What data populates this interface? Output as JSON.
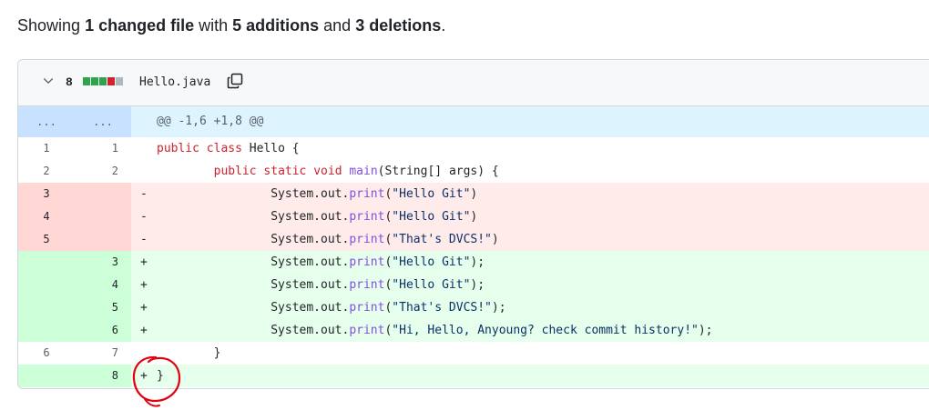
{
  "summary": {
    "prefix": "Showing ",
    "files": "1 changed file",
    "mid": " with ",
    "additions": "5 additions",
    "and": " and ",
    "deletions": "3 deletions",
    "suffix": "."
  },
  "file": {
    "change_count": "8",
    "name": "Hello.java",
    "diffstat_colors": [
      "#2da44e",
      "#2da44e",
      "#2da44e",
      "#cf222e",
      "#afb8c1"
    ]
  },
  "hunk": {
    "old": "...",
    "new": "...",
    "header": "@@ -1,6 +1,8 @@"
  },
  "lines": [
    {
      "type": "ctx",
      "old": "1",
      "new": "1",
      "marker": "",
      "code": "public class Hello {"
    },
    {
      "type": "ctx",
      "old": "2",
      "new": "2",
      "marker": "",
      "code": "        public static void main(String[] args) {"
    },
    {
      "type": "del",
      "old": "3",
      "new": "",
      "marker": "-",
      "code": "                System.out.print(\"Hello Git\")"
    },
    {
      "type": "del",
      "old": "4",
      "new": "",
      "marker": "-",
      "code": "                System.out.print(\"Hello Git\")"
    },
    {
      "type": "del",
      "old": "5",
      "new": "",
      "marker": "-",
      "code": "                System.out.print(\"That's DVCS!\")"
    },
    {
      "type": "add",
      "old": "",
      "new": "3",
      "marker": "+",
      "code": "                System.out.print(\"Hello Git\");"
    },
    {
      "type": "add",
      "old": "",
      "new": "4",
      "marker": "+",
      "code": "                System.out.print(\"Hello Git\");"
    },
    {
      "type": "add",
      "old": "",
      "new": "5",
      "marker": "+",
      "code": "                System.out.print(\"That's DVCS!\");"
    },
    {
      "type": "add",
      "old": "",
      "new": "6",
      "marker": "+",
      "code": "                System.out.print(\"Hi, Hello, Anyoung? check commit history!\");"
    },
    {
      "type": "ctx",
      "old": "6",
      "new": "7",
      "marker": "",
      "code": "        }"
    },
    {
      "type": "add",
      "old": "",
      "new": "8",
      "marker": "+",
      "code": "}"
    }
  ],
  "colors": {
    "annotation": "#e3000f"
  }
}
